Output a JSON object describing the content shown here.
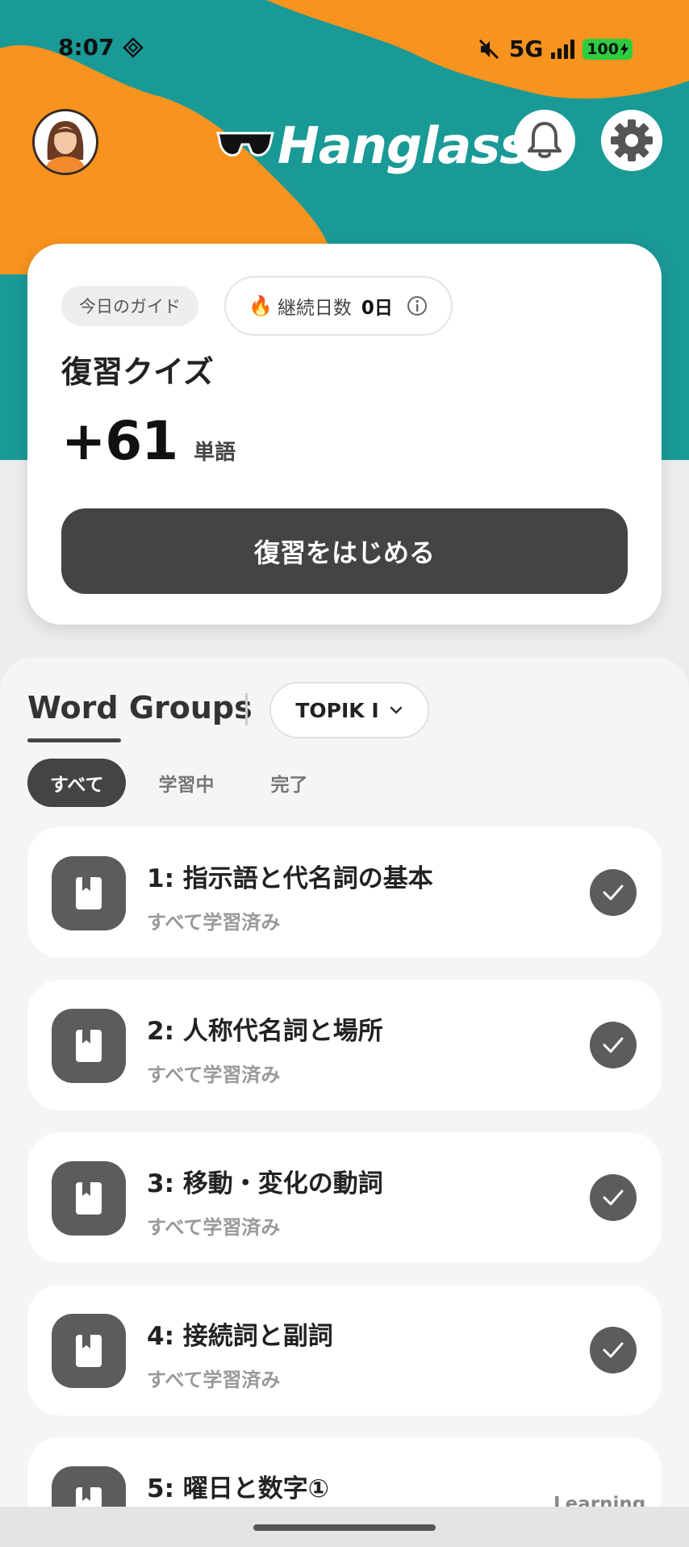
{
  "status_bar": {
    "time": "8:07",
    "network": "5G",
    "battery": "100"
  },
  "header": {
    "logo_text": "Hanglass",
    "avatar_icon": "user-avatar",
    "notification_icon": "bell-icon",
    "settings_icon": "gear-icon"
  },
  "guide_card": {
    "guide_label": "今日のガイド",
    "streak_label": "継続日数",
    "streak_value": "0日",
    "title": "復習クイズ",
    "count": "+61",
    "unit": "単語",
    "button_label": "復習をはじめる"
  },
  "word_groups": {
    "title": "Word Groups",
    "level": "TOPIK I",
    "filters": [
      "すべて",
      "学習中",
      "完了"
    ],
    "items": [
      {
        "title": "1: 指示語と代名詞の基本",
        "status": "すべて学習済み"
      },
      {
        "title": "2: 人称代名詞と場所",
        "status": "すべて学習済み"
      },
      {
        "title": "3: 移動・変化の動詞",
        "status": "すべて学習済み"
      },
      {
        "title": "4: 接続詞と副詞",
        "status": "すべて学習済み"
      },
      {
        "title": "5: 曜日と数字①",
        "status": "Learning"
      }
    ]
  },
  "colors": {
    "teal": "#1a9a96",
    "orange": "#f7931e",
    "dark": "#444444"
  }
}
